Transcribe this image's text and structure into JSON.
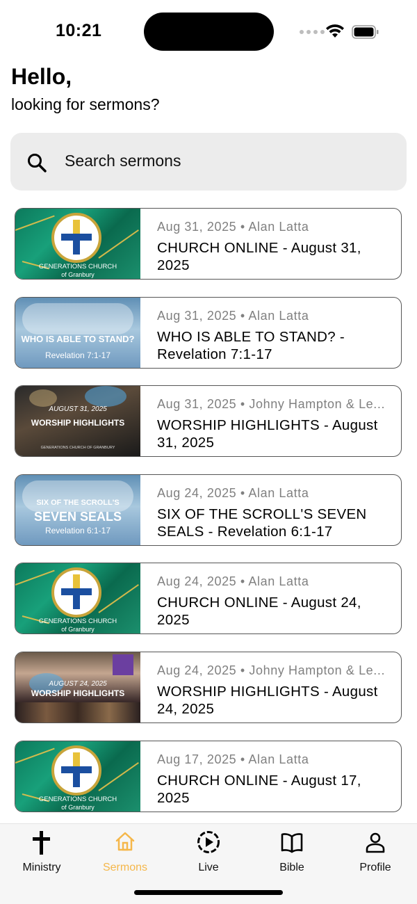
{
  "status_bar": {
    "time": "10:21"
  },
  "greeting": {
    "title": "Hello,",
    "subtitle": "looking for sermons?"
  },
  "search": {
    "placeholder": "Search sermons"
  },
  "sermons": [
    {
      "date": "Aug 31, 2025",
      "speaker": "Alan Latta",
      "meta": "Aug 31, 2025 • Alan Latta",
      "title": "CHURCH ONLINE - August 31, 2025",
      "thumbnail": {
        "kind": "church-logo",
        "caption1": "GENERATIONS CHURCH",
        "caption2": "of Granbury"
      }
    },
    {
      "date": "Aug 31, 2025",
      "speaker": "Alan Latta",
      "meta": "Aug 31, 2025 • Alan Latta",
      "title": "WHO IS ABLE TO STAND?  - Revelation 7:1-17",
      "thumbnail": {
        "kind": "sky-art",
        "line1": "WHO IS ABLE TO STAND?",
        "line2": "Revelation 7:1-17"
      }
    },
    {
      "date": "Aug 31, 2025",
      "speaker": "Johny Hampton & Le...",
      "meta": "Aug 31, 2025 • Johny Hampton & Le...",
      "title": "WORSHIP HIGHLIGHTS - August 31, 2025",
      "thumbnail": {
        "kind": "worship-dark",
        "line1": "AUGUST 31, 2025",
        "line2": "WORSHIP HIGHLIGHTS",
        "line3": "GENERATIONS CHURCH OF GRANBURY"
      }
    },
    {
      "date": "Aug 24, 2025",
      "speaker": "Alan Latta",
      "meta": "Aug 24, 2025 • Alan Latta",
      "title": "SIX OF THE SCROLL'S SEVEN SEALS - Revelation 6:1-17",
      "thumbnail": {
        "kind": "sky-art-seals",
        "line1": "SIX OF THE SCROLL'S",
        "line2": "SEVEN SEALS",
        "line3": "Revelation 6:1-17"
      }
    },
    {
      "date": "Aug 24, 2025",
      "speaker": "Alan Latta",
      "meta": "Aug 24, 2025 • Alan Latta",
      "title": "CHURCH ONLINE - August 24, 2025",
      "thumbnail": {
        "kind": "church-logo",
        "caption1": "GENERATIONS CHURCH",
        "caption2": "of Granbury"
      }
    },
    {
      "date": "Aug 24, 2025",
      "speaker": "Johny Hampton & Le...",
      "meta": "Aug 24, 2025 • Johny Hampton & Le...",
      "title": "WORSHIP HIGHLIGHTS - August 24, 2025",
      "thumbnail": {
        "kind": "worship-stage",
        "line1": "AUGUST 24, 2025",
        "line2": "WORSHIP HIGHLIGHTS"
      }
    },
    {
      "date": "Aug 17, 2025",
      "speaker": "Alan Latta",
      "meta": "Aug 17, 2025 • Alan Latta",
      "title": "CHURCH ONLINE - August 17, 2025",
      "thumbnail": {
        "kind": "church-logo",
        "caption1": "GENERATIONS CHURCH",
        "caption2": "of Granbury"
      }
    }
  ],
  "tab_bar": {
    "tabs": [
      {
        "label": "Ministry",
        "icon": "cross-icon",
        "active": false
      },
      {
        "label": "Sermons",
        "icon": "home-icon",
        "active": true
      },
      {
        "label": "Live",
        "icon": "play-circle-icon",
        "active": false
      },
      {
        "label": "Bible",
        "icon": "book-icon",
        "active": false
      },
      {
        "label": "Profile",
        "icon": "person-icon",
        "active": false
      }
    ]
  },
  "colors": {
    "accent": "#f5b74a",
    "search_bg": "#ececec",
    "meta_text": "#808080",
    "tab_bg": "#f6f6f6"
  }
}
